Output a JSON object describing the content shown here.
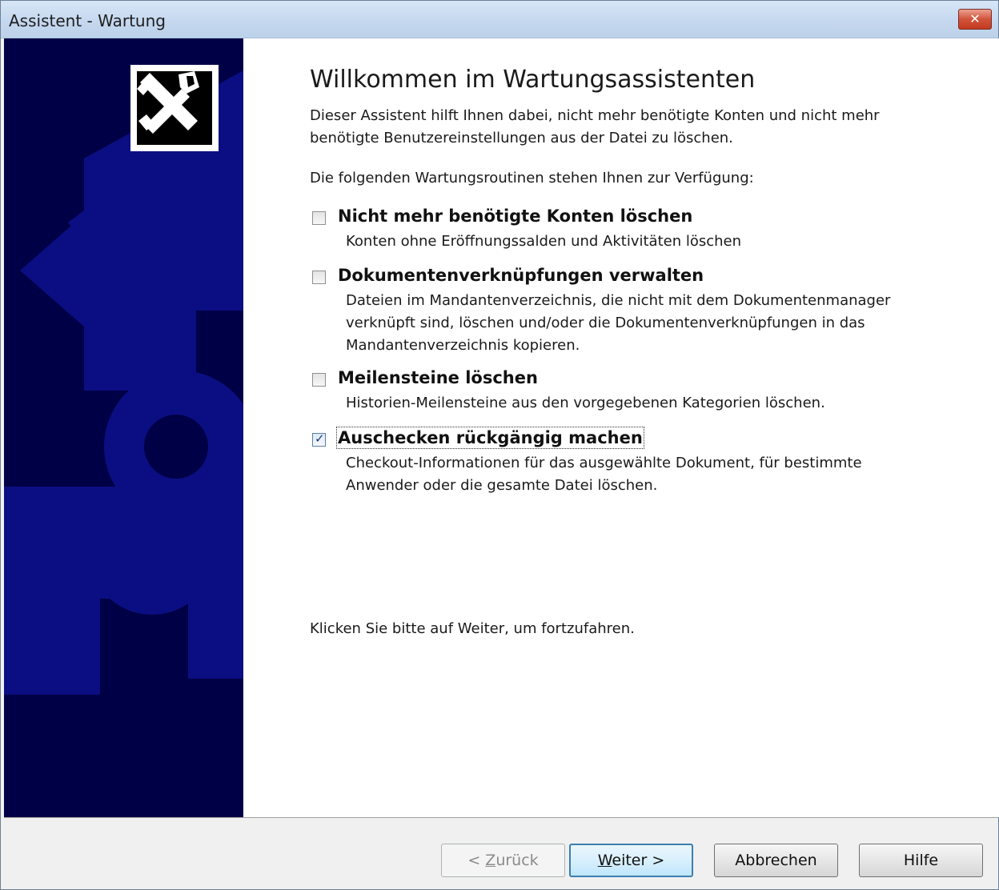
{
  "window": {
    "title": "Assistent - Wartung",
    "close_label": "✕"
  },
  "heading": "Willkommen im Wartungsassistenten",
  "intro": "Dieser Assistent hilft Ihnen dabei, nicht mehr benötigte Konten und nicht mehr benötigte Benutzereinstellungen aus der Datei zu löschen.",
  "lead": "Die folgenden Wartungsroutinen stehen Ihnen zur Verfügung:",
  "options": [
    {
      "title": "Nicht mehr benötigte Konten löschen",
      "desc": "Konten ohne Eröffnungssalden und Aktivitäten löschen",
      "checked": false
    },
    {
      "title": "Dokumentenverknüpfungen verwalten",
      "desc": "Dateien im Mandantenverzeichnis, die nicht mit dem Dokumentenmanager verknüpft sind, löschen und/oder die Dokumentenverknüpfungen in das Mandantenverzeichnis kopieren.",
      "checked": false
    },
    {
      "title": "Meilensteine löschen",
      "desc": "Historien-Meilensteine aus den vorgegebenen Kategorien löschen.",
      "checked": false
    },
    {
      "title": "Auschecken rückgängig machen",
      "desc": "Checkout-Informationen für das ausgewählte Dokument, für bestimmte Anwender oder die gesamte Datei löschen.",
      "checked": true
    }
  ],
  "footer_text": "Klicken Sie bitte auf Weiter, um fortzufahren.",
  "buttons": {
    "back": {
      "prefix": "< ",
      "accel": "Z",
      "rest": "urück"
    },
    "next": {
      "accel": "W",
      "rest": "eiter >"
    },
    "cancel": "Abbrechen",
    "help": "Hilfe"
  },
  "icons": {
    "logo": "tools-icon",
    "close": "close-icon",
    "check": "checkmark-icon"
  },
  "colors": {
    "sidebar": "#000046",
    "watermark": "#0b0e82",
    "title_bar": "#c4d7ee"
  }
}
